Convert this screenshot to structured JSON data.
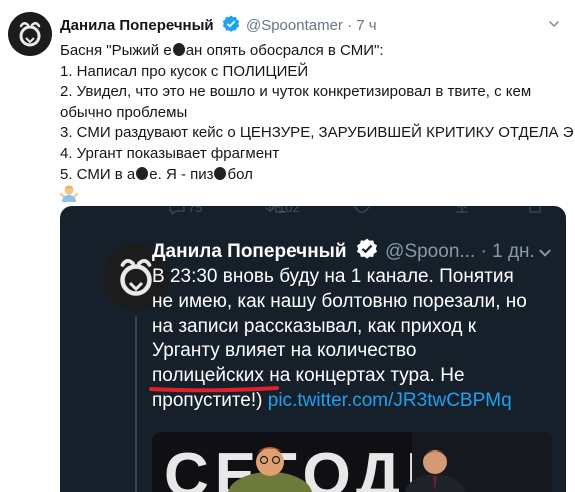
{
  "tweet": {
    "author_name": "Данила Поперечный",
    "handle": "@Spoontamer",
    "separator": "·",
    "time": "7 ч",
    "lines": [
      "Басня \"Рыжий е",
      "ан опять обосрался в СМИ\":",
      "1. Написал про кусок с ПОЛИЦИЕЙ",
      "2. Увидел, что это не вошло и чуток конкретизировал в твите, с кем",
      "обычно проблемы",
      "3. СМИ раздувают кейс о ЦЕНЗУРЕ, ЗАРУБИВШЕЙ КРИТИКУ ОТДЕЛА Э",
      "4. Ургант показывает фрагмент",
      "5. СМИ в а",
      "е. Я - пиз",
      "бол"
    ],
    "emoji_icon": "man-shrugging-emoji"
  },
  "embedded_tweet": {
    "author_name": "Данила Поперечный",
    "handle": "@Spoon...",
    "separator": "·",
    "time": "1 дн.",
    "lines": [
      "В 23:30 вновь буду на 1 канале. Понятия",
      "не имею, как нашу болтовню порезали, но",
      "на записи рассказывал, как приход к",
      "Урганту влияет на количество",
      "полицейских",
      " на концертах тура. Не",
      "пропустите!)",
      "pic.twitter.com/JR3twCBPMq"
    ],
    "ghost_counts": [
      "75",
      "102"
    ],
    "photo_text": "СЕГОДНЯ"
  },
  "colors": {
    "link": "#1da1f2",
    "verified": "#1da1f2",
    "underline": "#e0212b",
    "embed_bg": "#15202b"
  }
}
